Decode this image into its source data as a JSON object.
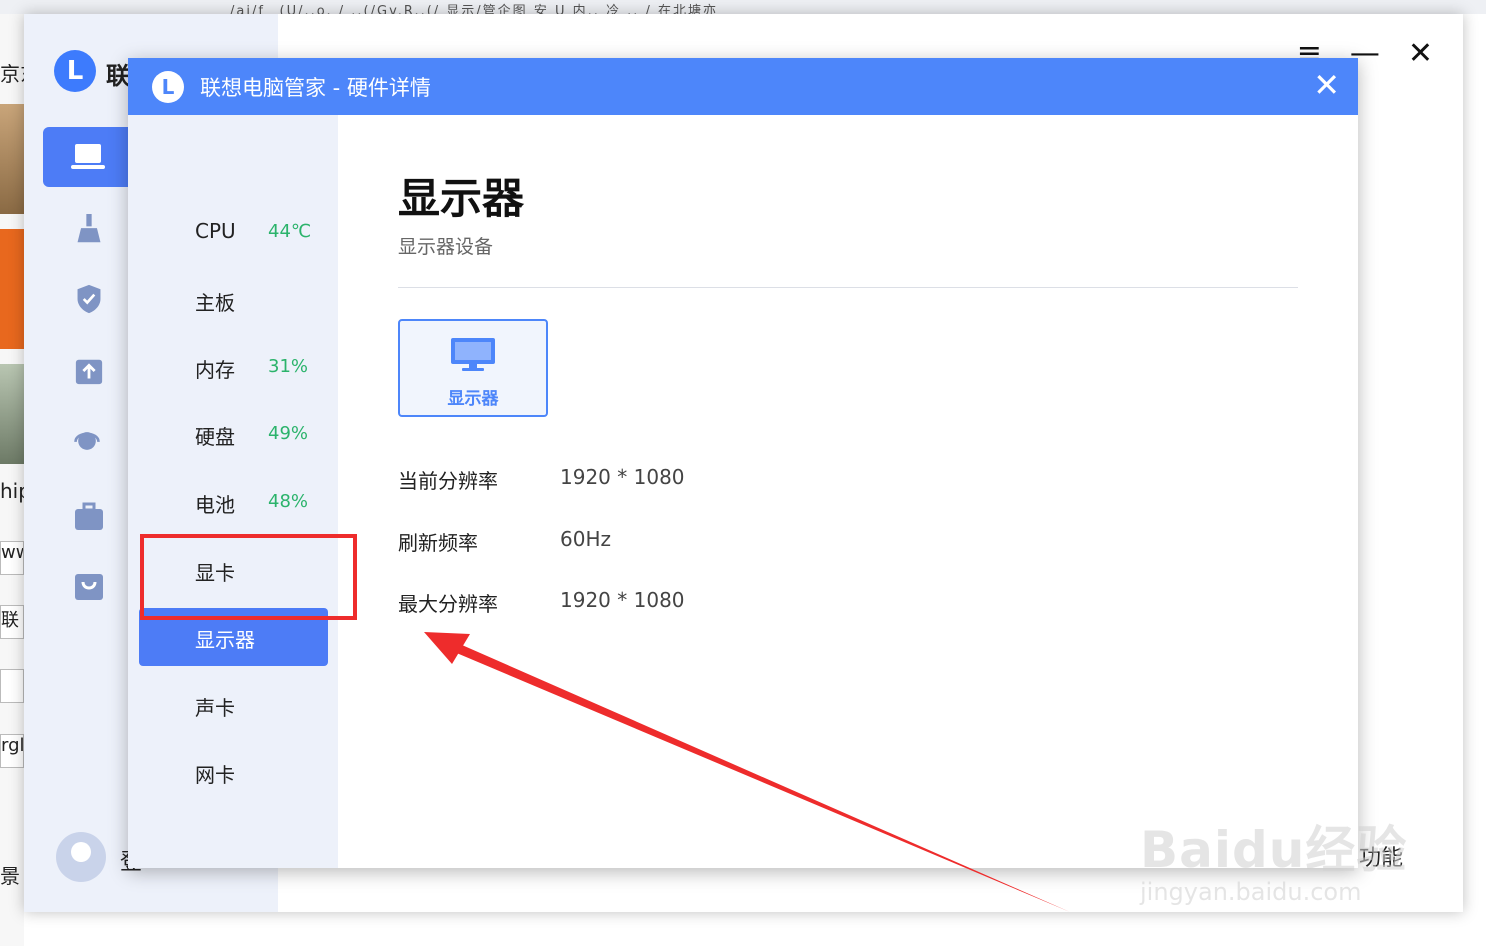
{
  "background": {
    "top_text": "/ai/f_ (U/..o. / ..(/Gv.R..(/ 显示/管企图 安 U 内.. 冷 .. /  在北塘亦",
    "left_fragments": [
      "京东",
      "hip",
      "ww",
      "联",
      "rgl",
      "景"
    ]
  },
  "main_window": {
    "brand": "联",
    "side_fragment": "登",
    "bottom_fragment": "功能",
    "controls": {
      "menu": "≡",
      "minimize": "—",
      "close": "✕"
    }
  },
  "dialog": {
    "title": "联想电脑管家 - 硬件详情",
    "logo": "L",
    "close": "✕",
    "sidebar": [
      {
        "label": "CPU",
        "value": "44℃"
      },
      {
        "label": "主板",
        "value": ""
      },
      {
        "label": "内存",
        "value": "31%"
      },
      {
        "label": "硬盘",
        "value": "49%"
      },
      {
        "label": "电池",
        "value": "48%"
      },
      {
        "label": "显卡",
        "value": ""
      },
      {
        "label": "显示器",
        "value": "",
        "active": true
      },
      {
        "label": "声卡",
        "value": ""
      },
      {
        "label": "网卡",
        "value": ""
      }
    ],
    "content": {
      "title": "显示器",
      "subtitle": "显示器设备",
      "device_card": "显示器",
      "rows": [
        {
          "key": "当前分辨率",
          "value": "1920 * 1080"
        },
        {
          "key": "刷新频率",
          "value": "60Hz"
        },
        {
          "key": "最大分辨率",
          "value": "1920 * 1080"
        }
      ]
    }
  },
  "colors": {
    "accent": "#4d86fa",
    "active": "#4d7cf6",
    "good": "#2bb36b",
    "annotation": "#ee2c2c"
  },
  "watermark": {
    "main": "Baidu经验",
    "sub": "jingyan.baidu.com"
  }
}
